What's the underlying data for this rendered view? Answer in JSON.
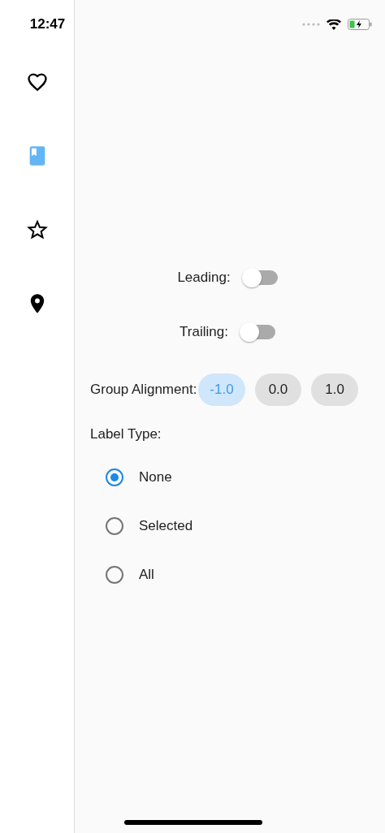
{
  "status_bar": {
    "time": "12:47"
  },
  "nav_rail": {
    "items": [
      {
        "kind": "heart",
        "selected": false
      },
      {
        "kind": "bookmark",
        "selected": true
      },
      {
        "kind": "star",
        "selected": false
      },
      {
        "kind": "pin",
        "selected": false
      }
    ]
  },
  "switches": [
    {
      "label": "Leading:",
      "on": false
    },
    {
      "label": "Trailing:",
      "on": false
    }
  ],
  "group_alignment": {
    "label": "Group Alignment:",
    "options": [
      {
        "label": "-1.0",
        "selected": true
      },
      {
        "label": "0.0",
        "selected": false
      },
      {
        "label": "1.0",
        "selected": false
      }
    ]
  },
  "label_type": {
    "label": "Label Type:",
    "options": [
      {
        "label": "None",
        "selected": true
      },
      {
        "label": "Selected",
        "selected": false
      },
      {
        "label": "All",
        "selected": false
      }
    ]
  }
}
